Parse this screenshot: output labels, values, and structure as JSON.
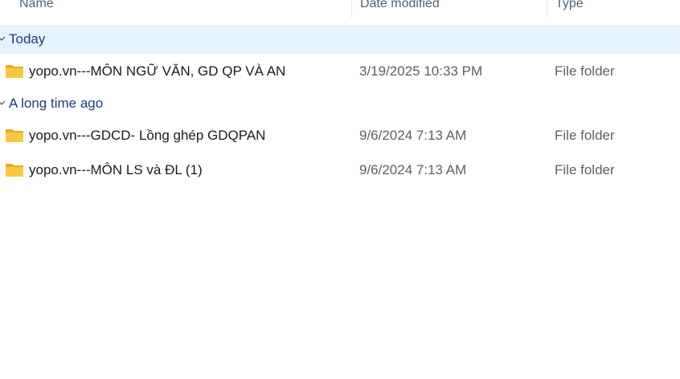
{
  "columns": {
    "name": "Name",
    "date_modified": "Date modified",
    "type": "Type"
  },
  "groups": [
    {
      "label": "Today",
      "items": [
        {
          "name": "yopo.vn---MÔN NGỮ VĂN, GD QP VÀ AN",
          "date": "3/19/2025 10:33 PM",
          "type": "File folder"
        }
      ]
    },
    {
      "label": "A long time ago",
      "items": [
        {
          "name": "yopo.vn---GDCD- Lồng ghép GDQPAN",
          "date": "9/6/2024 7:13 AM",
          "type": "File folder"
        },
        {
          "name": "yopo.vn---MÔN LS và ĐL (1)",
          "date": "9/6/2024 7:13 AM",
          "type": "File folder"
        }
      ]
    }
  ],
  "colors": {
    "selected_group_bg": "#e5f3ff",
    "group_label": "#1f3d7a",
    "folder_yellow": "#f8c93a"
  },
  "icons": {
    "folder": "folder-icon",
    "chevron": "chevron-down-icon"
  }
}
